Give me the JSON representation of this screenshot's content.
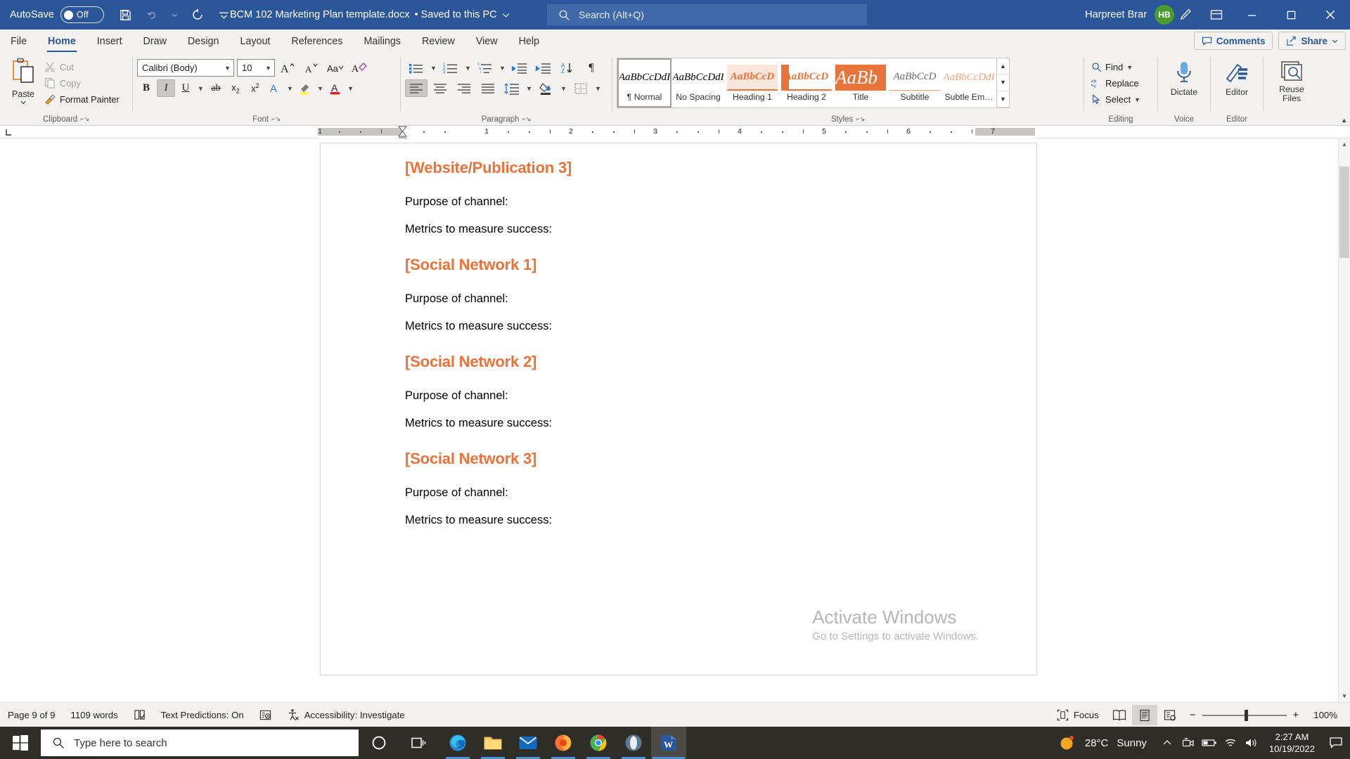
{
  "titlebar": {
    "autosave_label": "AutoSave",
    "autosave_state": "Off",
    "doc_title": "BCM 102 Marketing Plan template.docx",
    "saved_status": "• Saved to this PC",
    "search_placeholder": "Search (Alt+Q)",
    "user_name": "Harpreet Brar",
    "user_initials": "HB",
    "qat": [
      "save-icon",
      "undo-icon",
      "redo-icon",
      "customize-qat-icon"
    ],
    "right_icons": [
      "pen-icon",
      "ribbon-display-options-icon"
    ],
    "window_buttons": [
      "minimize-icon",
      "maximize-icon",
      "close-icon"
    ]
  },
  "tabs": [
    {
      "label": "File",
      "active": false
    },
    {
      "label": "Home",
      "active": true
    },
    {
      "label": "Insert",
      "active": false
    },
    {
      "label": "Draw",
      "active": false
    },
    {
      "label": "Design",
      "active": false
    },
    {
      "label": "Layout",
      "active": false
    },
    {
      "label": "References",
      "active": false
    },
    {
      "label": "Mailings",
      "active": false
    },
    {
      "label": "Review",
      "active": false
    },
    {
      "label": "View",
      "active": false
    },
    {
      "label": "Help",
      "active": false
    }
  ],
  "tabbar_right": {
    "comments_label": "Comments",
    "share_label": "Share"
  },
  "ribbon": {
    "clipboard": {
      "group_label": "Clipboard",
      "paste_label": "Paste",
      "items": [
        {
          "label": "Cut",
          "icon": "scissors-icon",
          "enabled": false
        },
        {
          "label": "Copy",
          "icon": "copy-icon",
          "enabled": false
        },
        {
          "label": "Format Painter",
          "icon": "format-painter-icon",
          "enabled": true
        }
      ]
    },
    "font": {
      "group_label": "Font",
      "font_family": "Calibri (Body)",
      "font_size": "10",
      "buttons_row1": [
        "grow-font-icon",
        "shrink-font-icon",
        "change-case-icon",
        "clear-formatting-icon"
      ],
      "buttons_row2": [
        "bold-icon",
        "italic-icon",
        "underline-icon",
        "strikethrough-icon",
        "subscript-icon",
        "superscript-icon",
        "text-effects-icon",
        "text-highlight-icon",
        "font-color-icon"
      ],
      "active_buttons": [
        "italic-icon"
      ]
    },
    "paragraph": {
      "group_label": "Paragraph",
      "buttons_row1": [
        "bullets-icon",
        "numbering-icon",
        "multilevel-list-icon",
        "decrease-indent-icon",
        "increase-indent-icon",
        "sort-icon",
        "show-marks-icon"
      ],
      "buttons_row2": [
        "align-left-icon",
        "align-center-icon",
        "align-right-icon",
        "justify-icon",
        "line-spacing-icon",
        "shading-icon",
        "borders-icon"
      ],
      "active_buttons": [
        "align-left-icon"
      ]
    },
    "styles": {
      "group_label": "Styles",
      "items": [
        {
          "preview": "AaBbCcDdI",
          "name": "¶ Normal",
          "kind": "normal",
          "selected": true
        },
        {
          "preview": "AaBbCcDdI",
          "name": "No Spacing",
          "kind": "normal",
          "selected": false
        },
        {
          "preview": "AaBbCcD",
          "name": "Heading 1",
          "kind": "heading1",
          "selected": false
        },
        {
          "preview": "AaBbCcD",
          "name": "Heading 2",
          "kind": "heading2",
          "selected": false
        },
        {
          "preview": "AaBb",
          "name": "Title",
          "kind": "title",
          "selected": false
        },
        {
          "preview": "AaBbCcD",
          "name": "Subtitle",
          "kind": "subtitle",
          "selected": false
        },
        {
          "preview": "AaBbCcDdI",
          "name": "Subtle Em…",
          "kind": "subtle",
          "selected": false
        }
      ]
    },
    "editing": {
      "group_label": "Editing",
      "items": [
        {
          "label": "Find",
          "icon": "search-icon",
          "caret": true
        },
        {
          "label": "Replace",
          "icon": "replace-icon",
          "caret": false
        },
        {
          "label": "Select",
          "icon": "select-cursor-icon",
          "caret": true
        }
      ]
    },
    "voice": {
      "group_label": "Voice",
      "button_label": "Dictate",
      "icon": "microphone-icon"
    },
    "editor": {
      "group_label": "Editor",
      "button_label": "Editor",
      "icon": "editor-pencil-icon"
    },
    "reuse": {
      "group_label": "Reuse Files",
      "button_label": "Reuse Files",
      "icon": "reuse-files-icon"
    }
  },
  "ruler": {
    "ticks": [
      "1",
      "1",
      "2",
      "3",
      "4",
      "5",
      "6",
      "7"
    ],
    "tab_stop_icon": "left-tab-stop-icon"
  },
  "document": {
    "blocks": [
      {
        "type": "heading",
        "text": "[Website/Publication 3]"
      },
      {
        "type": "body",
        "text": "Purpose of channel:"
      },
      {
        "type": "body",
        "text": "Metrics to measure success:"
      },
      {
        "type": "heading",
        "text": "[Social Network 1]"
      },
      {
        "type": "body",
        "text": "Purpose of channel:"
      },
      {
        "type": "body",
        "text": "Metrics to measure success:"
      },
      {
        "type": "heading",
        "text": "[Social Network 2]"
      },
      {
        "type": "body",
        "text": "Purpose of channel:"
      },
      {
        "type": "body",
        "text": "Metrics to measure success:"
      },
      {
        "type": "heading",
        "text": "[Social Network 3]"
      },
      {
        "type": "body",
        "text": "Purpose of channel:"
      },
      {
        "type": "body",
        "text": "Metrics to measure success:"
      }
    ],
    "watermark_line1": "Activate Windows",
    "watermark_line2": "Go to Settings to activate Windows.",
    "heading_color": "#e8743b"
  },
  "statusbar": {
    "page_info": "Page 9 of 9",
    "word_count": "1109 words",
    "proofing_icon": "proofing-icon",
    "text_predictions": "Text Predictions: On",
    "predictions_icon": "predictions-icon",
    "accessibility_icon": "accessibility-icon",
    "accessibility": "Accessibility: Investigate",
    "focus_label": "Focus",
    "focus_icon": "focus-icon",
    "views": [
      "read-mode-icon",
      "print-layout-icon",
      "web-layout-icon"
    ],
    "active_view": "print-layout-icon",
    "zoom_out": "−",
    "zoom_in": "+",
    "zoom_level": "100%"
  },
  "taskbar": {
    "start_icon": "windows-start-icon",
    "search_placeholder": "Type here to search",
    "search_icon": "search-icon",
    "cortana_icon": "cortana-circle-icon",
    "taskview_icon": "task-view-icon",
    "apps": [
      {
        "name": "microsoft-edge-icon",
        "running": true,
        "active": false
      },
      {
        "name": "file-explorer-icon",
        "running": true,
        "active": false
      },
      {
        "name": "mail-icon",
        "running": true,
        "active": false
      },
      {
        "name": "firefox-icon",
        "running": true,
        "active": false
      },
      {
        "name": "google-chrome-icon",
        "running": true,
        "active": false
      },
      {
        "name": "opera-icon",
        "running": true,
        "active": false
      },
      {
        "name": "microsoft-word-icon",
        "running": true,
        "active": true
      }
    ],
    "weather_temp": "28°C",
    "weather_condition": "Sunny",
    "tray_icons": [
      "show-hidden-icons-icon",
      "camera-icon",
      "battery-icon",
      "wifi-icon",
      "volume-icon"
    ],
    "time": "2:27 AM",
    "date": "10/19/2022",
    "notification_icon": "notification-icon"
  }
}
